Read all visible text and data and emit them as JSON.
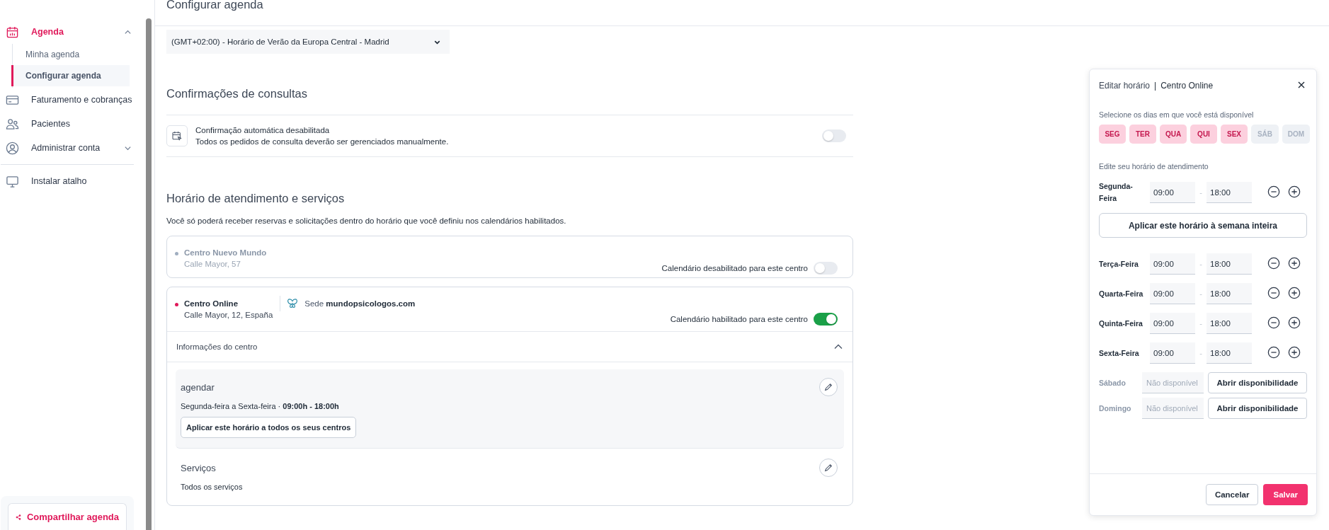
{
  "sidebar": {
    "items": [
      {
        "label": "Agenda",
        "selected": true,
        "expanded": true,
        "children": [
          {
            "label": "Minha agenda",
            "selected": false
          },
          {
            "label": "Configurar agenda",
            "selected": true
          }
        ]
      },
      {
        "label": "Faturamento e cobranças",
        "selected": false
      },
      {
        "label": "Pacientes",
        "selected": false
      },
      {
        "label": "Administrar conta",
        "selected": false,
        "expanded": false
      }
    ],
    "extra_items": [
      {
        "label": "Instalar atalho"
      }
    ],
    "share_button": "Compartilhar agenda"
  },
  "page_title": "Configurar agenda",
  "timezone": {
    "value": "(GMT+02:00) - Horário de Verão da Europa Central - Madrid"
  },
  "confirmations": {
    "title": "Confirmações de consultas",
    "setting_title": "Confirmação automática desabilitada",
    "setting_description": "Todos os pedidos de consulta deverão ser gerenciados manualmente.",
    "on": false
  },
  "hours": {
    "title": "Horário de atendimento e serviços",
    "description": "Você só poderá receber reservas e solicitações dentro do horário que você definiu nos calendários habilitados.",
    "centers": [
      {
        "name": "Centro Nuevo Mundo",
        "address": "Calle Mayor, 57",
        "color": "#a0aec0",
        "status": "Calendário desabilitado para este centro",
        "on": false
      },
      {
        "name": "Centro Online",
        "address": "Calle Mayor, 12, España",
        "color": "#e0195a",
        "site_prefix": "Sede",
        "site": "mundopsicologos.com",
        "status": "Calendário habilitado para este centro",
        "on": true,
        "details": {
          "label": "Informações do centro",
          "expanded": true,
          "schedule": {
            "title": "agendar",
            "days": "Segunda-feira a Sexta-feira ·",
            "hours": "09:00h - 18:00h",
            "apply_button": "Aplicar este horário a todos os seus centros"
          },
          "services": {
            "title": "Serviços",
            "text": "Todos os serviços"
          }
        }
      }
    ]
  },
  "edit_panel": {
    "title": "Editar horário",
    "separator": "|",
    "center": "Centro Online",
    "days_label": "Selecione os dias em que você está disponível",
    "days": [
      {
        "label": "SEG",
        "selected": true
      },
      {
        "label": "TER",
        "selected": true
      },
      {
        "label": "QUA",
        "selected": true
      },
      {
        "label": "QUI",
        "selected": true
      },
      {
        "label": "SEX",
        "selected": true
      },
      {
        "label": "SÁB",
        "selected": false
      },
      {
        "label": "DOM",
        "selected": false
      }
    ],
    "hours_label": "Edite seu horário de atendimento",
    "rows": [
      {
        "kind": "hours",
        "day": "Segunda-Feira",
        "from": "09:00",
        "separator": "-",
        "to": "18:00"
      },
      {
        "kind": "apply",
        "label": "Aplicar este horário à semana inteira"
      },
      {
        "kind": "hours",
        "day": "Terça-Feira",
        "from": "09:00",
        "separator": "-",
        "to": "18:00"
      },
      {
        "kind": "hours",
        "day": "Quarta-Feira",
        "from": "09:00",
        "separator": "-",
        "to": "18:00"
      },
      {
        "kind": "hours",
        "day": "Quinta-Feira",
        "from": "09:00",
        "separator": "-",
        "to": "18:00"
      },
      {
        "kind": "hours",
        "day": "Sexta-Feira",
        "from": "09:00",
        "separator": "-",
        "to": "18:00"
      },
      {
        "kind": "closed",
        "day": "Sábado",
        "placeholder": "Não disponível",
        "button": "Abrir disponibilidade"
      },
      {
        "kind": "closed",
        "day": "Domingo",
        "placeholder": "Não disponível",
        "button": "Abrir disponibilidade"
      }
    ],
    "cancel": "Cancelar",
    "save": "Salvar"
  }
}
